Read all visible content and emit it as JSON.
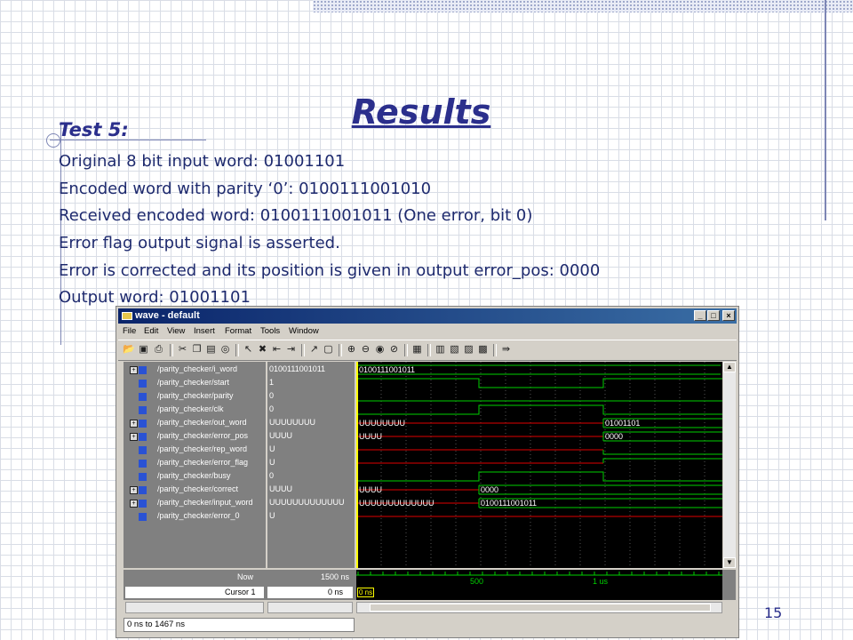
{
  "slide": {
    "title": "Results",
    "subtitle": "Test 5:",
    "lines": [
      "Original 8 bit input word: 01001101",
      "Encoded word with parity ‘0’: 0100111001010",
      "Received encoded word: 0100111001011 (One error, bit 0)",
      "Error flag output signal is asserted.",
      "Error is corrected and its position is given in output error_pos: 0000",
      "Output word: 01001101"
    ],
    "page_number": "15"
  },
  "wave_window": {
    "title": "wave - default",
    "window_buttons": [
      "_",
      "□",
      "×"
    ],
    "menu": [
      "File",
      "Edit",
      "View",
      "Insert",
      "Format",
      "Tools",
      "Window"
    ],
    "toolbar_icons": [
      "open-icon",
      "save-icon",
      "print-icon",
      "cut-icon",
      "copy-icon",
      "paste-icon",
      "find-icon",
      "select-icon",
      "delete-icon",
      "insert-cursor-icon",
      "delete-cursor-icon",
      "pointer-icon",
      "zoom-region-icon",
      "zoom-in-icon",
      "zoom-out-icon",
      "zoom-full-icon",
      "zoom-cursor-icon",
      "edge-prev-icon",
      "edge-next-icon",
      "find-edge-icon",
      "find-value-icon",
      "stop-icon"
    ],
    "signals": [
      {
        "name": "/parity_checker/i_word",
        "value": "0100111001011",
        "expandable": true
      },
      {
        "name": "/parity_checker/start",
        "value": "1",
        "expandable": false
      },
      {
        "name": "/parity_checker/parity",
        "value": "0",
        "expandable": false
      },
      {
        "name": "/parity_checker/clk",
        "value": "0",
        "expandable": false
      },
      {
        "name": "/parity_checker/out_word",
        "value": "UUUUUUUU",
        "expandable": true
      },
      {
        "name": "/parity_checker/error_pos",
        "value": "UUUU",
        "expandable": true
      },
      {
        "name": "/parity_checker/rep_word",
        "value": "U",
        "expandable": false
      },
      {
        "name": "/parity_checker/error_flag",
        "value": "U",
        "expandable": false
      },
      {
        "name": "/parity_checker/busy",
        "value": "0",
        "expandable": false
      },
      {
        "name": "/parity_checker/correct",
        "value": "UUUU",
        "expandable": true
      },
      {
        "name": "/parity_checker/input_word",
        "value": "UUUUUUUUUUUUU",
        "expandable": true
      },
      {
        "name": "/parity_checker/error_0",
        "value": "U",
        "expandable": false
      }
    ],
    "wave_labels": {
      "i_word": "0100111001011",
      "out_word_before": "UUUUUUUU",
      "out_word_after": "01001101",
      "error_pos_before": "UUUU",
      "error_pos_after": "0000",
      "correct_before": "UUUU",
      "correct_after": "0000",
      "input_word_before": "UUUUUUUUUUUUU",
      "input_word_after": "0100111001011"
    },
    "now_label": "Now",
    "now_value": "1500 ns",
    "cursor_label": "Cursor 1",
    "cursor_value": "0 ns",
    "cursor_marker": "0 ns",
    "timeline_ticks": [
      "500",
      "1 us"
    ],
    "status_range": "0 ns to 1467 ns",
    "colors": {
      "wave_green": "#00d000",
      "wave_red": "#e00000",
      "cursor": "#ffff00",
      "title_blue": "#2b2f8c"
    }
  }
}
